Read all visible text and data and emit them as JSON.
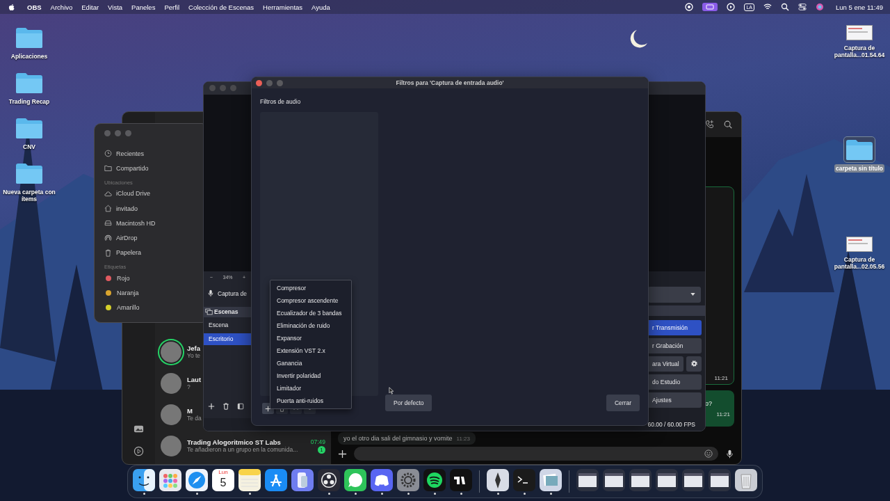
{
  "menu_bar": {
    "app": "OBS",
    "menus": [
      "Archivo",
      "Editar",
      "Vista",
      "Paneles",
      "Perfil",
      "Colección de Escenas",
      "Herramientas",
      "Ayuda"
    ],
    "input_source": "LA",
    "clock": "Lun 5 ene 11:49"
  },
  "desktop_left": [
    {
      "label": "Aplicaciones",
      "kind": "folder",
      "selected": false
    },
    {
      "label": "Trading Recap",
      "kind": "folder",
      "selected": false
    },
    {
      "label": "CNV",
      "kind": "folder",
      "selected": false
    },
    {
      "label": "Nueva carpeta con ítems",
      "kind": "folder",
      "selected": false
    }
  ],
  "desktop_right": [
    {
      "label": "Captura de pantalla...01.54.64",
      "kind": "screenshot",
      "selected": false
    },
    {
      "label": "carpeta sin título",
      "kind": "folder",
      "selected": true
    },
    {
      "label": "Captura de pantalla...02.05.56",
      "kind": "screenshot",
      "selected": false
    }
  ],
  "whatsapp": {
    "chats": [
      {
        "name": "Jefa",
        "preview": "Yo te",
        "ring": true
      },
      {
        "name": "Laut",
        "preview": "?",
        "ring": false
      },
      {
        "name": "M",
        "preview": "Te da",
        "ring": false
      },
      {
        "name": "Trading Alogoritmico ST Labs",
        "preview": "Te añadieron a un grupo en la comunida...",
        "time": "07:49",
        "unread": "1",
        "ring": false
      }
    ],
    "messages": [
      {
        "kind": "out",
        "time": "11:21"
      },
      {
        "kind": "out-green",
        "text": "o?",
        "time": "11:21"
      },
      {
        "kind": "in",
        "text": "yo el otro dia sali del gimnasio y vomite",
        "time": "11:23"
      }
    ]
  },
  "finder": {
    "favorites": [
      {
        "label": "Recientes",
        "kind": "clock"
      },
      {
        "label": "Compartido",
        "kind": "shared"
      }
    ],
    "locations_title": "Ubicaciones",
    "locations": [
      {
        "label": "iCloud Drive",
        "kind": "cloud"
      },
      {
        "label": "invitado",
        "kind": "home"
      },
      {
        "label": "Macintosh HD",
        "kind": "disk"
      },
      {
        "label": "AirDrop",
        "kind": "airdrop"
      },
      {
        "label": "Papelera",
        "kind": "trash"
      }
    ],
    "tags_title": "Etiquetas",
    "tags": [
      {
        "label": "Rojo",
        "color": "#e05a60"
      },
      {
        "label": "Naranja",
        "color": "#d9a42e"
      },
      {
        "label": "Amarillo",
        "color": "#d4cf2a"
      }
    ]
  },
  "obs": {
    "zoom": {
      "minus": "−",
      "value": "34%",
      "plus": "+"
    },
    "source": "Captura de",
    "scenes": {
      "title": "Escenas",
      "items": [
        {
          "label": "Escena",
          "selected": false
        },
        {
          "label": "Escritorio",
          "selected": true
        }
      ]
    },
    "controls": [
      {
        "label": "r Transmisión",
        "kind": "primary"
      },
      {
        "label": "r Grabación",
        "kind": "normal"
      },
      {
        "label": "ara Virtual",
        "kind": "with-settings"
      },
      {
        "label": "do Estudio",
        "kind": "normal"
      },
      {
        "label": "Ajustes",
        "kind": "normal"
      }
    ],
    "fps": "60.00 / 60.00 FPS"
  },
  "filters_dialog": {
    "title": "Filtros para 'Captura de entrada audio'",
    "section": "Filtros de audio",
    "menu": [
      "Compresor",
      "Compresor ascendente",
      "Ecualizador de 3 bandas",
      "Eliminación de ruido",
      "Expansor",
      "Extensión VST 2.x",
      "Ganancia",
      "Invertir polaridad",
      "Limitador",
      "Puerta anti-ruidos"
    ],
    "buttons": [
      "Por defecto",
      "Cerrar"
    ]
  },
  "dock": {
    "calendar_day": "Lun",
    "calendar_date": "5",
    "apps": [
      {
        "kind": "finder",
        "running": true
      },
      {
        "kind": "launchpad",
        "running": false
      },
      {
        "kind": "safari",
        "running": true
      },
      {
        "kind": "calendar",
        "running": false
      },
      {
        "kind": "notes",
        "running": true
      },
      {
        "kind": "appstore",
        "running": false
      },
      {
        "kind": "phone",
        "running": false
      },
      {
        "kind": "obs",
        "running": true
      },
      {
        "kind": "whatsapp",
        "running": true
      },
      {
        "kind": "discord",
        "running": true
      },
      {
        "kind": "settings",
        "running": true
      },
      {
        "kind": "spotify",
        "running": true
      },
      {
        "kind": "chart",
        "running": true
      },
      {
        "kind": "divider"
      },
      {
        "kind": "pen",
        "running": true
      },
      {
        "kind": "terminal",
        "running": true
      },
      {
        "kind": "preview",
        "running": true
      },
      {
        "kind": "divider"
      },
      {
        "kind": "thumb",
        "running": false
      },
      {
        "kind": "thumb",
        "running": false
      },
      {
        "kind": "thumb",
        "running": false
      },
      {
        "kind": "thumb",
        "running": false
      },
      {
        "kind": "thumb",
        "running": false
      },
      {
        "kind": "thumb",
        "running": false
      },
      {
        "kind": "trash",
        "running": false
      }
    ]
  }
}
